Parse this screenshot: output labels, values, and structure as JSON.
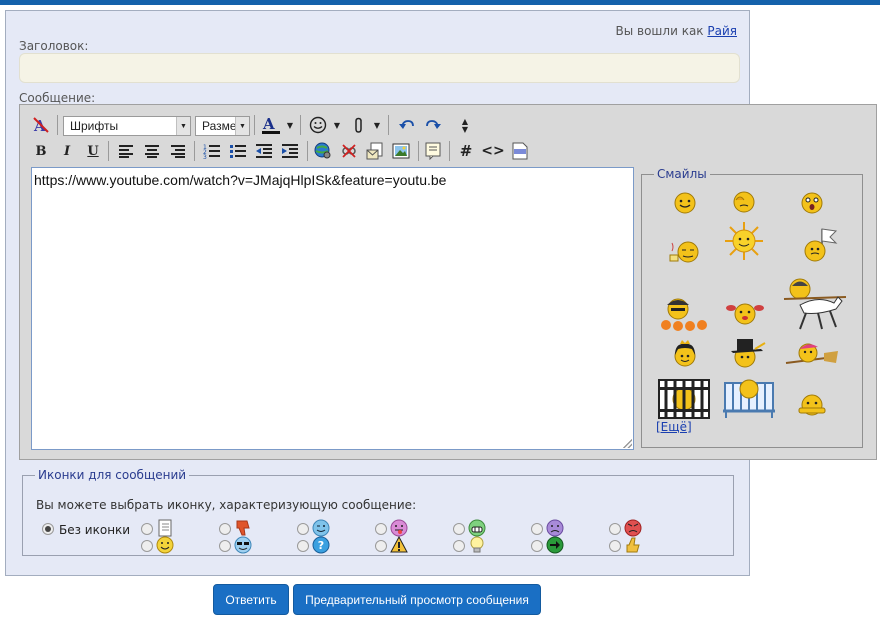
{
  "header": {
    "login_prefix": "Вы вошли как",
    "username": "Райя"
  },
  "form": {
    "title_label": "Заголовок:",
    "title_value": "",
    "message_label": "Сообщение:",
    "message_value": "https://www.youtube.com/watch?v=JMajqHlpISk&feature=youtu.be"
  },
  "toolbar": {
    "font_select": "Шрифты",
    "size_select": "Разме",
    "bold_label": "B",
    "italic_label": "I",
    "underline_label": "U",
    "hash_label": "#",
    "code_label": "<>"
  },
  "smilies": {
    "legend": "Смайлы",
    "more_label": "[Ещё]"
  },
  "post_icons": {
    "legend": "Иконки для сообщений",
    "hint": "Вы можете выбрать иконку, характеризующую сообщение:",
    "no_icon_label": "Без иконки",
    "selected": "none",
    "icons": [
      "document-icon",
      "thumbs-down-icon",
      "wink-icon",
      "tongue-icon",
      "grin-icon",
      "sad-icon",
      "angry-icon",
      "smile-icon",
      "cool-icon",
      "question-icon",
      "warning-icon",
      "lightbulb-icon",
      "arrow-right-icon",
      "thumbs-up-icon"
    ]
  },
  "actions": {
    "reply_label": "Ответить",
    "preview_label": "Предварительный просмотр сообщения"
  },
  "colors": {
    "accent": "#1a6fc4",
    "topbar": "#1462ab",
    "panel": "#e5e9f6",
    "editor": "#d9d9d9"
  }
}
